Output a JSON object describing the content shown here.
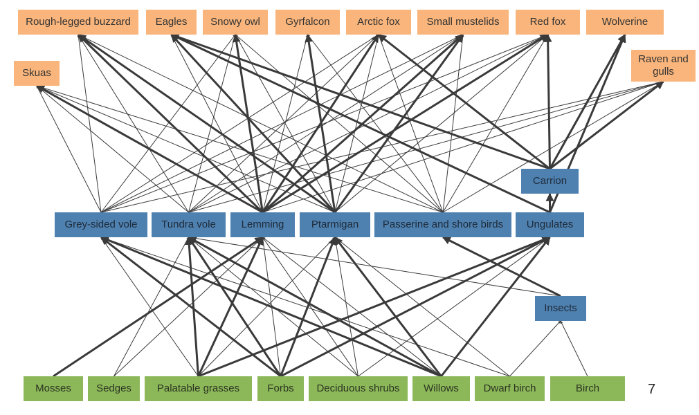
{
  "nodes": [
    {
      "id": "rlb",
      "label": "Rough-legged buzzard",
      "level": "predator"
    },
    {
      "id": "eag",
      "label": "Eagles",
      "level": "predator"
    },
    {
      "id": "owl",
      "label": "Snowy owl",
      "level": "predator"
    },
    {
      "id": "gyr",
      "label": "Gyrfalcon",
      "level": "predator"
    },
    {
      "id": "afx",
      "label": "Arctic fox",
      "level": "predator"
    },
    {
      "id": "mus",
      "label": "Small mustelids",
      "level": "predator"
    },
    {
      "id": "rfx",
      "label": "Red fox",
      "level": "predator"
    },
    {
      "id": "wol",
      "label": "Wolverine",
      "level": "predator"
    },
    {
      "id": "sku",
      "label": "Skuas",
      "level": "predator"
    },
    {
      "id": "rav",
      "label": "Raven and gulls",
      "level": "predator"
    },
    {
      "id": "car",
      "label": "Carrion",
      "level": "intermediate"
    },
    {
      "id": "gsv",
      "label": "Grey-sided vole",
      "level": "herbivore"
    },
    {
      "id": "tuv",
      "label": "Tundra vole",
      "level": "herbivore"
    },
    {
      "id": "lem",
      "label": "Lemming",
      "level": "herbivore"
    },
    {
      "id": "pta",
      "label": "Ptarmigan",
      "level": "herbivore"
    },
    {
      "id": "pas",
      "label": "Passerine and shore birds",
      "level": "herbivore"
    },
    {
      "id": "ung",
      "label": "Ungulates",
      "level": "herbivore"
    },
    {
      "id": "ins",
      "label": "Insects",
      "level": "herbivore"
    },
    {
      "id": "mos",
      "label": "Mosses",
      "level": "plant"
    },
    {
      "id": "sed",
      "label": "Sedges",
      "level": "plant"
    },
    {
      "id": "pgr",
      "label": "Palatable grasses",
      "level": "plant"
    },
    {
      "id": "frb",
      "label": "Forbs",
      "level": "plant"
    },
    {
      "id": "dsh",
      "label": "Deciduous shrubs",
      "level": "plant"
    },
    {
      "id": "wil",
      "label": "Willows",
      "level": "plant"
    },
    {
      "id": "dbi",
      "label": "Dwarf birch",
      "level": "plant"
    },
    {
      "id": "bir",
      "label": "Birch",
      "level": "plant"
    }
  ],
  "edges": [
    [
      "gsv",
      "rlb",
      0
    ],
    [
      "gsv",
      "owl",
      0
    ],
    [
      "gsv",
      "afx",
      0
    ],
    [
      "gsv",
      "mus",
      0
    ],
    [
      "gsv",
      "rfx",
      0
    ],
    [
      "gsv",
      "sku",
      0
    ],
    [
      "gsv",
      "rav",
      0
    ],
    [
      "tuv",
      "rlb",
      0
    ],
    [
      "tuv",
      "owl",
      0
    ],
    [
      "tuv",
      "afx",
      0
    ],
    [
      "tuv",
      "mus",
      0
    ],
    [
      "tuv",
      "rfx",
      0
    ],
    [
      "tuv",
      "sku",
      0
    ],
    [
      "tuv",
      "rav",
      0
    ],
    [
      "lem",
      "rlb",
      1
    ],
    [
      "lem",
      "owl",
      1
    ],
    [
      "lem",
      "afx",
      1
    ],
    [
      "lem",
      "mus",
      1
    ],
    [
      "lem",
      "rfx",
      1
    ],
    [
      "lem",
      "sku",
      1
    ],
    [
      "lem",
      "eag",
      0
    ],
    [
      "lem",
      "rav",
      0
    ],
    [
      "lem",
      "gyr",
      0
    ],
    [
      "pta",
      "gyr",
      1
    ],
    [
      "pta",
      "eag",
      1
    ],
    [
      "pta",
      "rlb",
      1
    ],
    [
      "pta",
      "owl",
      0
    ],
    [
      "pta",
      "afx",
      0
    ],
    [
      "pta",
      "mus",
      1
    ],
    [
      "pta",
      "rfx",
      0
    ],
    [
      "pta",
      "sku",
      0
    ],
    [
      "pas",
      "rlb",
      0
    ],
    [
      "pas",
      "owl",
      0
    ],
    [
      "pas",
      "gyr",
      0
    ],
    [
      "pas",
      "afx",
      0
    ],
    [
      "pas",
      "mus",
      0
    ],
    [
      "pas",
      "rfx",
      0
    ],
    [
      "pas",
      "sku",
      0
    ],
    [
      "pas",
      "rav",
      0
    ],
    [
      "ung",
      "car",
      1
    ],
    [
      "ung",
      "wol",
      1
    ],
    [
      "ung",
      "eag",
      1
    ],
    [
      "car",
      "rfx",
      1
    ],
    [
      "car",
      "wol",
      1
    ],
    [
      "car",
      "rav",
      1
    ],
    [
      "car",
      "eag",
      1
    ],
    [
      "car",
      "afx",
      1
    ],
    [
      "ins",
      "pas",
      1
    ],
    [
      "ins",
      "tuv",
      0
    ],
    [
      "mos",
      "lem",
      1
    ],
    [
      "sed",
      "lem",
      0
    ],
    [
      "sed",
      "tuv",
      0
    ],
    [
      "pgr",
      "tuv",
      1
    ],
    [
      "pgr",
      "lem",
      1
    ],
    [
      "pgr",
      "pta",
      0
    ],
    [
      "pgr",
      "ung",
      1
    ],
    [
      "pgr",
      "gsv",
      0
    ],
    [
      "frb",
      "gsv",
      1
    ],
    [
      "frb",
      "tuv",
      1
    ],
    [
      "frb",
      "lem",
      0
    ],
    [
      "frb",
      "pta",
      1
    ],
    [
      "frb",
      "ung",
      1
    ],
    [
      "dsh",
      "lem",
      0
    ],
    [
      "dsh",
      "pta",
      0
    ],
    [
      "dsh",
      "tuv",
      0
    ],
    [
      "dsh",
      "ung",
      0
    ],
    [
      "wil",
      "gsv",
      1
    ],
    [
      "wil",
      "tuv",
      1
    ],
    [
      "wil",
      "pta",
      1
    ],
    [
      "wil",
      "ung",
      1
    ],
    [
      "wil",
      "lem",
      0
    ],
    [
      "dbi",
      "pta",
      0
    ],
    [
      "dbi",
      "ins",
      0
    ],
    [
      "dbi",
      "gsv",
      0
    ],
    [
      "bir",
      "ins",
      0
    ]
  ],
  "colors": {
    "predator": "#F9B57B",
    "herbivore": "#4F81B0",
    "plant": "#8CB85A",
    "edge": "#3a3a3a"
  },
  "page_number": "7"
}
